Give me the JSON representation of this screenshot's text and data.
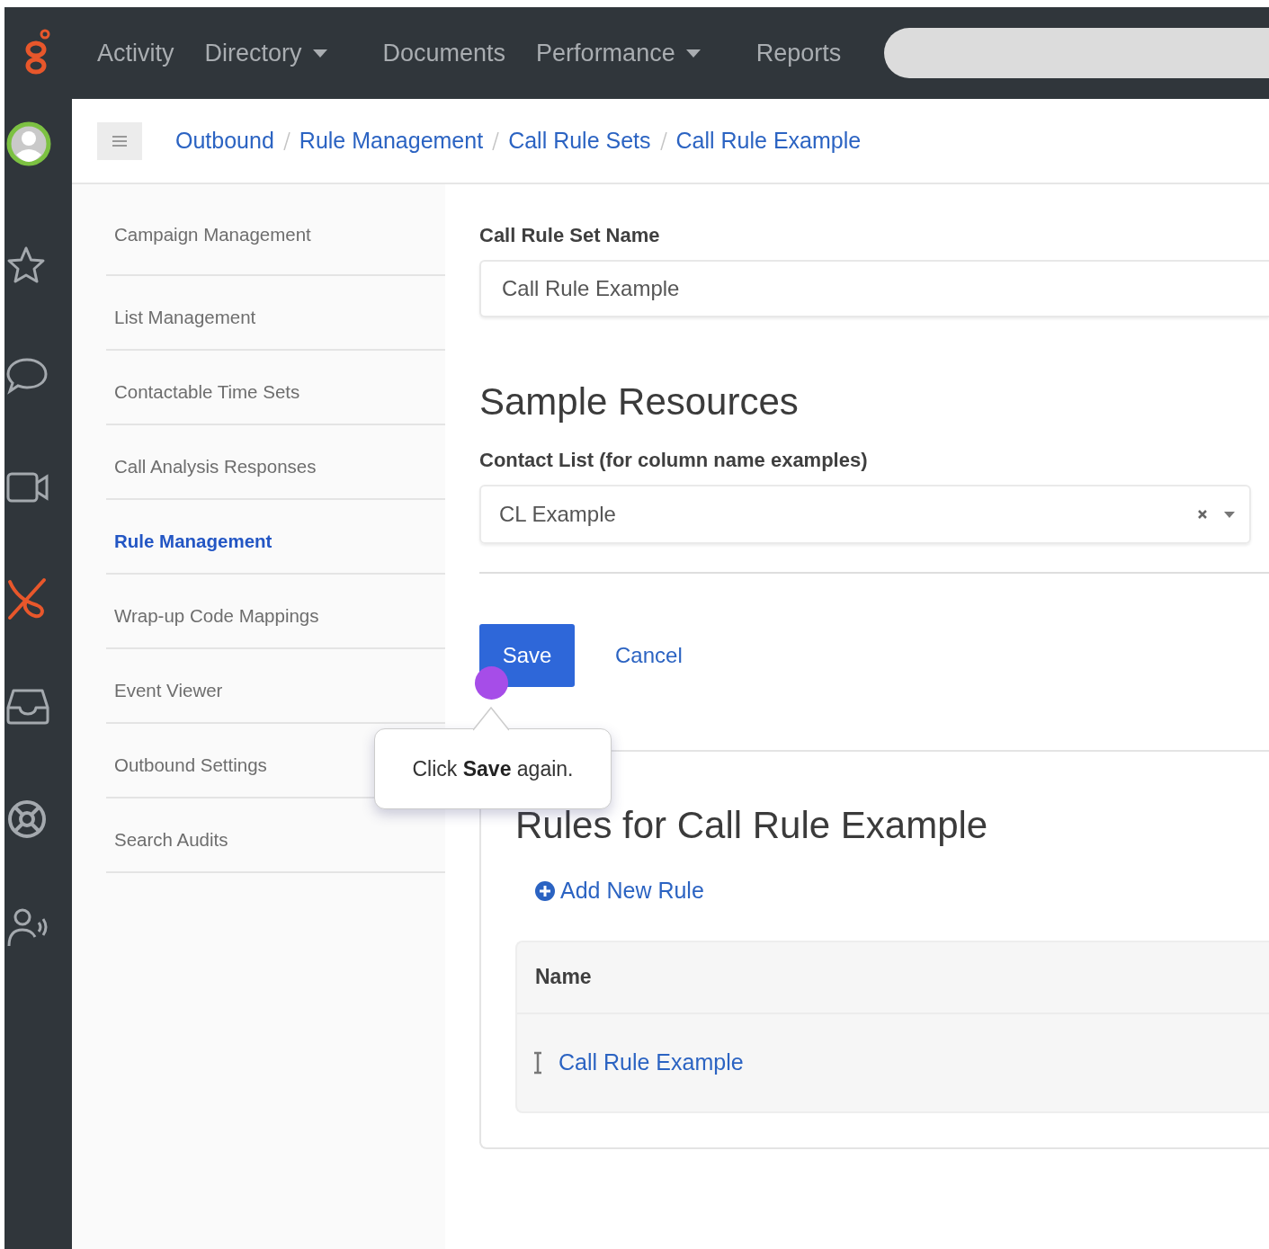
{
  "top_nav": {
    "items": [
      {
        "label": "Activity",
        "dropdown": false
      },
      {
        "label": "Directory",
        "dropdown": true
      },
      {
        "label": "Documents",
        "dropdown": false
      },
      {
        "label": "Performance",
        "dropdown": true
      },
      {
        "label": "Reports",
        "dropdown": false
      }
    ]
  },
  "rail": [
    {
      "kind": "avatar",
      "selected": false
    },
    {
      "kind": "star",
      "selected": false
    },
    {
      "kind": "chat",
      "selected": false
    },
    {
      "kind": "video",
      "selected": false
    },
    {
      "kind": "outbound",
      "selected": true
    },
    {
      "kind": "inbox",
      "selected": false
    },
    {
      "kind": "help",
      "selected": false
    },
    {
      "kind": "agent",
      "selected": false
    }
  ],
  "breadcrumb": [
    "Outbound",
    "Rule Management",
    "Call Rule Sets",
    "Call Rule Example"
  ],
  "sidebar": {
    "items": [
      {
        "label": "Campaign Management",
        "selected": false
      },
      {
        "label": "List Management",
        "selected": false
      },
      {
        "label": "Contactable Time Sets",
        "selected": false
      },
      {
        "label": "Call Analysis Responses",
        "selected": false
      },
      {
        "label": "Rule Management",
        "selected": true
      },
      {
        "label": "Wrap-up Code Mappings",
        "selected": false
      },
      {
        "label": "Event Viewer",
        "selected": false
      },
      {
        "label": "Outbound Settings",
        "selected": false
      },
      {
        "label": "Search Audits",
        "selected": false
      }
    ]
  },
  "form": {
    "name_label": "Call Rule Set Name",
    "name_value": "Call Rule Example",
    "section_title": "Sample Resources",
    "contact_label": "Contact List (for column name examples)",
    "contact_value": "CL Example",
    "save": "Save",
    "cancel": "Cancel"
  },
  "tooltip": "Click **Save** again.",
  "rules": {
    "title": "Rules for Call Rule Example",
    "add_label": "Add New Rule",
    "columns": [
      "Name"
    ],
    "rows": [
      [
        "Call Rule Example"
      ]
    ]
  }
}
